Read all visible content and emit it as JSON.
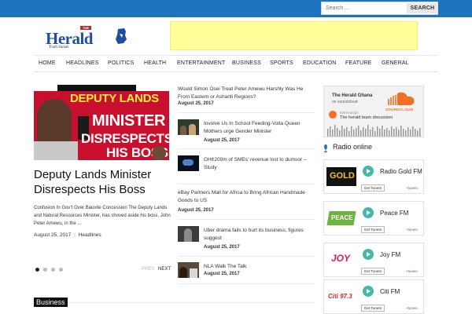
{
  "search": {
    "placeholder": "Search ...",
    "button_label": "SEARCH"
  },
  "header": {
    "logo_the": "THE",
    "logo_name": "Herald",
    "logo_tagline": "Truth Stands"
  },
  "nav": {
    "items": [
      "HOME",
      "HEADLINES",
      "POLITICS",
      "HEALTH",
      "ENTERTAINMENT",
      "BUSINESS",
      "SPORTS",
      "EDUCATION",
      "FEATURE",
      "GENERAL"
    ]
  },
  "featured": {
    "image_text": [
      "DEPUTY LANDS",
      "MINISTER",
      "DISRESPECTS",
      "HIS BOSS"
    ],
    "title": "Deputy Lands Minister Disrespects His Boss",
    "excerpt": "Confusion In Gov’t Over Bauxite Concession The Deputy Lands and Natural Resources Minister, has shoved aside his boss, John Peter Amewu, in the ...",
    "date": "August 25, 2017",
    "separator": "|",
    "category": "Headlines",
    "prev_label": "PREV",
    "next_label": "NEXT"
  },
  "articles": [
    {
      "title": "Would Simon Osei Treat Peter Amewu Harshly Was He From Eastern or Ashanti Regions?",
      "date": "August 25, 2017",
      "has_thumb": false
    },
    {
      "title": "Involve Us In School Feeding-Volta Queen Mothers urge Gender Minister",
      "date": "August 25, 2017",
      "has_thumb": true
    },
    {
      "title": "GH¢200m of SMEs’ revenue lost to dumsor – Study",
      "date": "August 25, 2017",
      "has_thumb": true
    },
    {
      "title": "eBay Partners Mall for Africa to Bring African Handmade Goods to US",
      "date": "August 25, 2017",
      "has_thumb": false
    },
    {
      "title": "Uber drama fails to hurt its business; figures suggest",
      "date": "August 25, 2017",
      "has_thumb": true
    },
    {
      "title": "NLA Walk The Talk",
      "date": "August 25, 2017",
      "has_thumb": true
    }
  ],
  "section": {
    "label": "Business"
  },
  "soundcloud": {
    "title": "The Herald Ghana",
    "subtitle": "on soundcloud",
    "brand": "SOUNDCLOUD",
    "user": "theheraldgh",
    "track": "The herald team discussion"
  },
  "radio": {
    "heading": "Radio online",
    "get_label": "Get TuneIn",
    "brand": "+tunein",
    "stations": [
      {
        "name": "Radio Gold FM",
        "logo_text": "GOLD",
        "logo_color": "#f3c21a"
      },
      {
        "name": "Peace FM",
        "logo_text": "PEACE",
        "logo_color": "#6db33f"
      },
      {
        "name": "Joy FM",
        "logo_text": "JOY",
        "logo_color": "#d81b60"
      },
      {
        "name": "Citi FM",
        "logo_text": "Citi 97.3",
        "logo_color": "#d7262d"
      }
    ]
  },
  "colors": {
    "brand_blue": "#1e73be",
    "ad_yellow": "#ffff99",
    "accent_teal": "#45b8ac",
    "soundcloud_orange": "#f26f23"
  }
}
